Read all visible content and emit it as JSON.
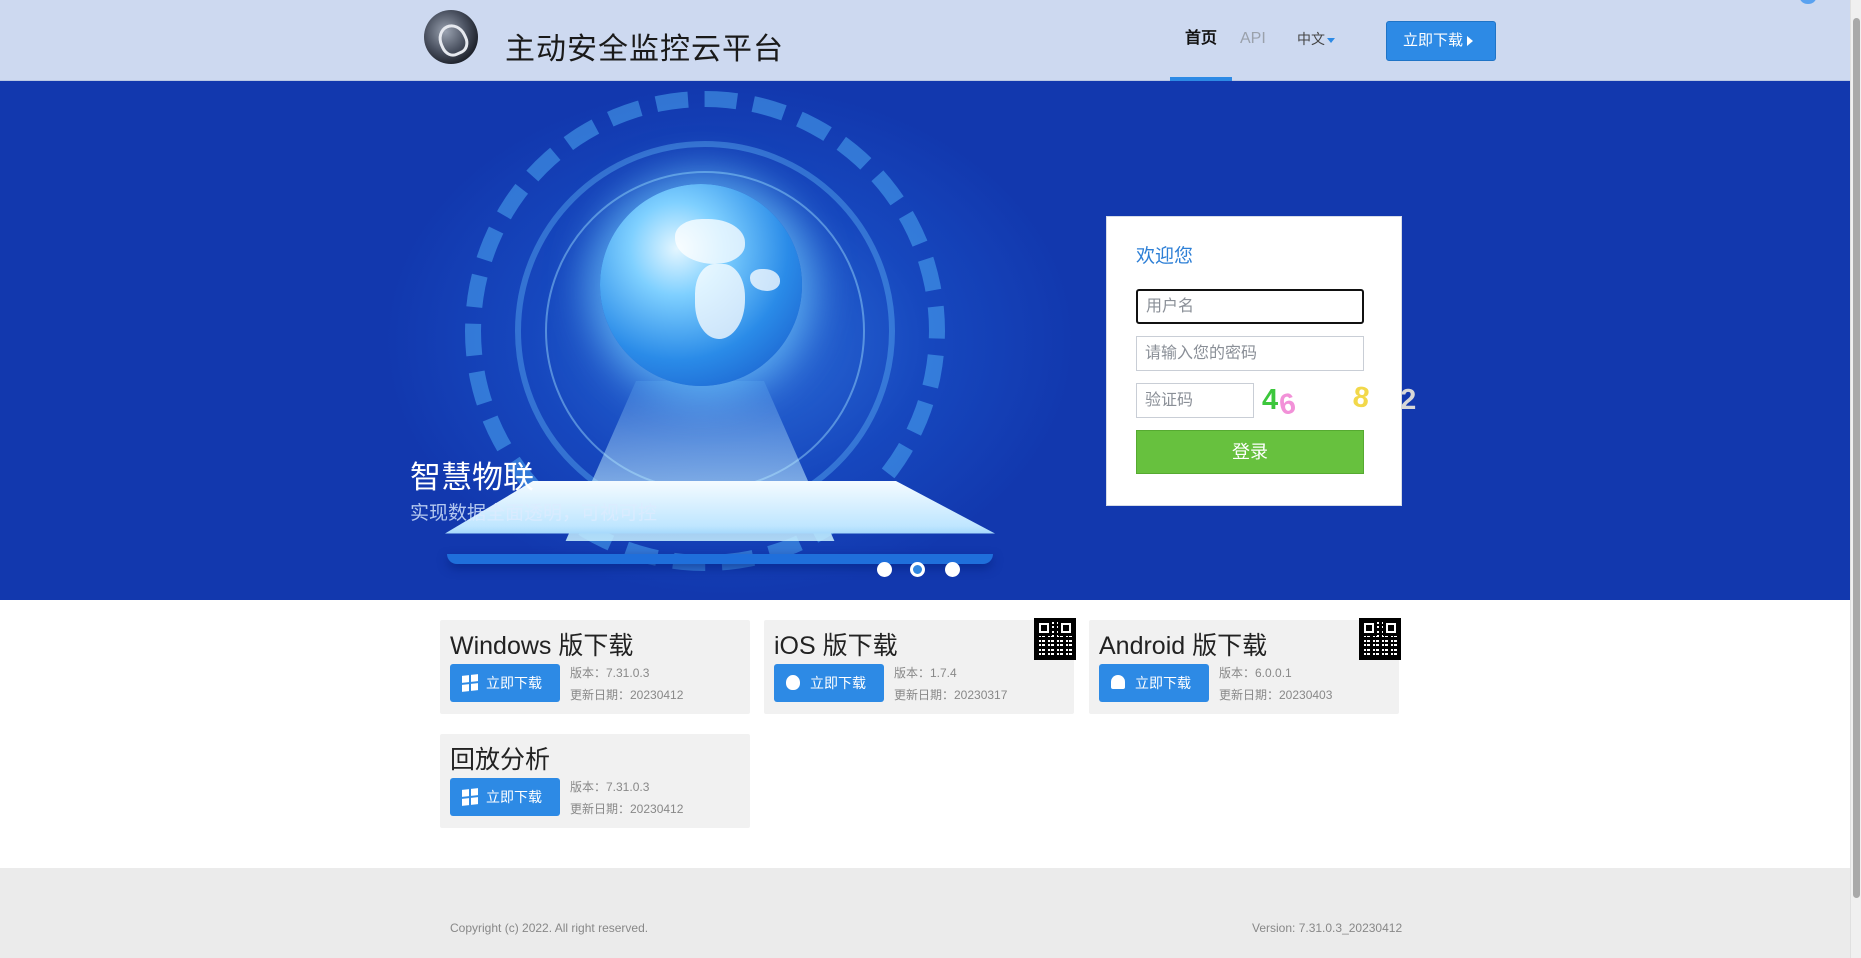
{
  "header": {
    "site_title": "主动安全监控云平台",
    "nav": {
      "home": "首页",
      "api": "API",
      "language": "中文"
    },
    "download_button": "立即下载"
  },
  "banner": {
    "slogan": "智慧物联",
    "sub_slogan": "实现数据全面透明，可视可控",
    "carousel_active_index": 1
  },
  "login": {
    "title": "欢迎您",
    "username_placeholder": "用户名",
    "password_placeholder": "请输入您的密码",
    "captcha_placeholder": "验证码",
    "captcha_code": [
      "4",
      "6",
      "8",
      "2"
    ],
    "submit_label": "登录"
  },
  "downloads": [
    {
      "title": "Windows 版下载",
      "button": "立即下载",
      "version": "版本：7.31.0.3",
      "date": "更新日期：20230412",
      "icon": "windows-icon"
    },
    {
      "title": "iOS 版下载",
      "button": "立即下载",
      "version": "版本：1.7.4",
      "date": "更新日期：20230317",
      "icon": "apple-icon"
    },
    {
      "title": "Android 版下载",
      "button": "立即下载",
      "version": "版本：6.0.0.1",
      "date": "更新日期：20230403",
      "icon": "android-icon"
    },
    {
      "title": "回放分析",
      "button": "立即下载",
      "version": "版本：7.31.0.3",
      "date": "更新日期：20230412",
      "icon": "windows-icon"
    }
  ],
  "footer": {
    "copyright": "Copyright (c) 2022. All right reserved.",
    "version": "Version: 7.31.0.3_20230412"
  },
  "colors": {
    "header_bg": "#cdd9f0",
    "banner_bg": "#1238ae",
    "accent_blue": "#2d8ae5",
    "login_green": "#67c13e",
    "footer_bg": "#ebebeb"
  }
}
